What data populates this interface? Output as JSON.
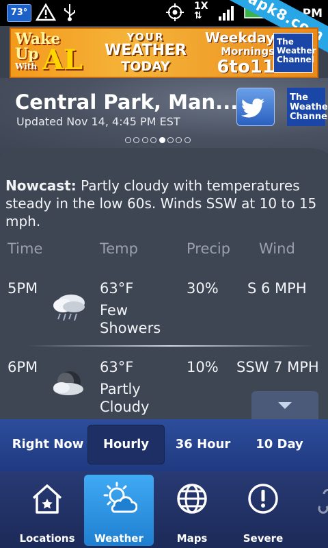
{
  "status_bar": {
    "temp_badge": "73°",
    "speed_label": "1X",
    "time": "PM",
    "watermark": "apk8.com"
  },
  "ad": {
    "wake_line1": "Wake Up",
    "wake_line2": "With",
    "wake_line3": "AL",
    "your": "YOUR",
    "weather": "WEATHER",
    "today": "TODAY",
    "weekday": "Weekday",
    "mornings": "Mornings",
    "hours": "6to11",
    "channel": "The Weather Channel"
  },
  "header": {
    "city": "Central Park, Man...",
    "updated": "Updated Nov 14, 4:45 PM EST",
    "twc_logo": "The Weather Channel",
    "page_count": 8,
    "active_page": 4
  },
  "nowcast": {
    "label": "Nowcast:",
    "text": " Partly cloudy with temperatures steady in the low 60s. Winds SSW at 10 to 15 mph."
  },
  "table": {
    "headers": [
      "Time",
      "Temp",
      "Precip",
      "Wind"
    ],
    "rows": [
      {
        "time": "5PM",
        "temp": "63°F",
        "cond1": "Few",
        "cond2": "Showers",
        "precip": "30%",
        "wind": "S 6 MPH",
        "icon": "rain-cloud-icon"
      },
      {
        "time": "6PM",
        "temp": "63°F",
        "cond1": "Partly",
        "cond2": "Cloudy",
        "precip": "10%",
        "wind": "SSW 7 MPH",
        "icon": "partly-cloudy-night-icon"
      }
    ]
  },
  "tabs": [
    "Right Now",
    "Hourly",
    "36 Hour",
    "10 Day"
  ],
  "nav": [
    "Locations",
    "Weather",
    "Maps",
    "Severe"
  ],
  "colors": {
    "accent": "#1f7fd0",
    "tab_bar": "#2d4d9c",
    "nav_bar": "#283a74"
  }
}
